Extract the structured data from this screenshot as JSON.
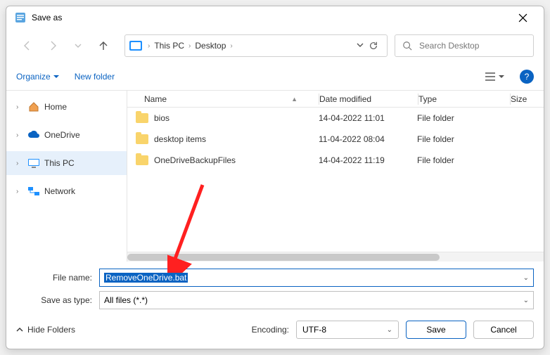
{
  "title": "Save as",
  "breadcrumb": {
    "root": "This PC",
    "seg2": "Desktop"
  },
  "search": {
    "placeholder": "Search Desktop"
  },
  "toolbar": {
    "organize": "Organize",
    "newfolder": "New folder"
  },
  "sidebar": {
    "items": [
      {
        "label": "Home"
      },
      {
        "label": "OneDrive"
      },
      {
        "label": "This PC"
      },
      {
        "label": "Network"
      }
    ]
  },
  "columns": {
    "name": "Name",
    "date": "Date modified",
    "type": "Type",
    "size": "Size"
  },
  "rows": [
    {
      "name": "bios",
      "date": "14-04-2022 11:01",
      "type": "File folder"
    },
    {
      "name": "desktop items",
      "date": "11-04-2022 08:04",
      "type": "File folder"
    },
    {
      "name": "OneDriveBackupFiles",
      "date": "14-04-2022 11:19",
      "type": "File folder"
    }
  ],
  "form": {
    "filename_label": "File name:",
    "filename_value": "RemoveOneDrive.bat",
    "type_label": "Save as type:",
    "type_value": "All files  (*.*)"
  },
  "footer": {
    "hide": "Hide Folders",
    "encoding_label": "Encoding:",
    "encoding_value": "UTF-8",
    "save": "Save",
    "cancel": "Cancel"
  }
}
